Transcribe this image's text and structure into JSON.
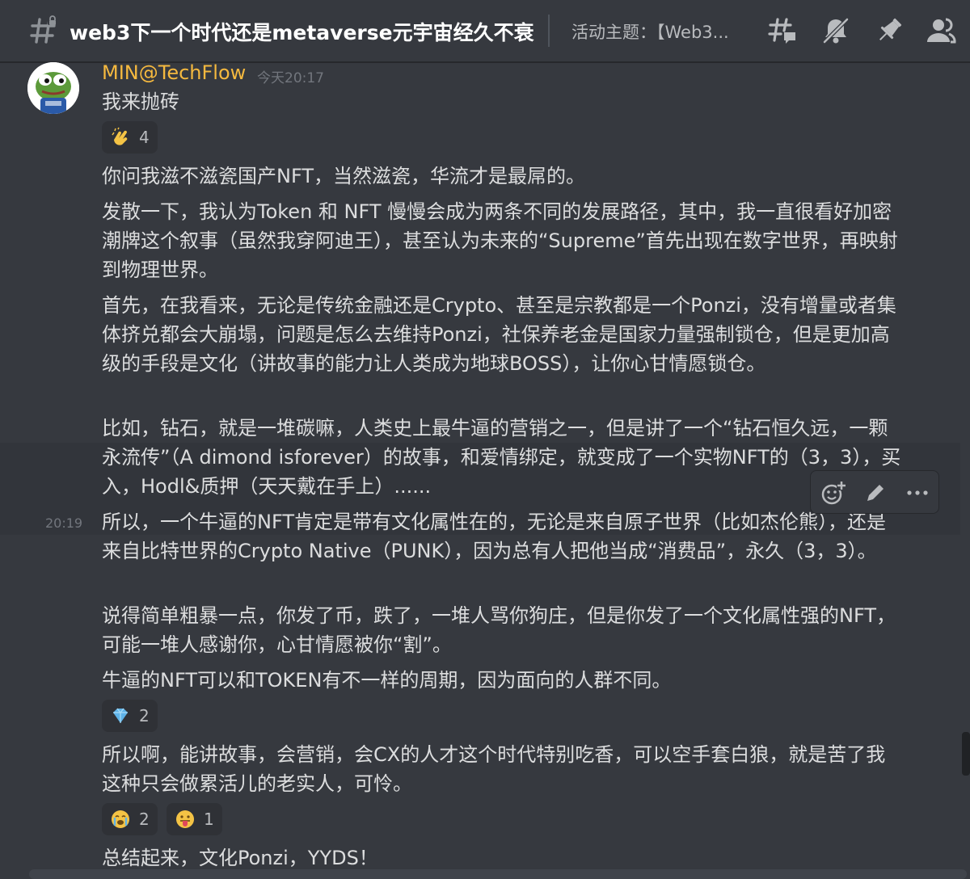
{
  "header": {
    "channel_name": "web3下一个时代还是metaverse元宇宙经久不衰",
    "topic": "活动主题：【Web3...",
    "icons": [
      "threads-icon",
      "mute-bell-icon",
      "pin-icon",
      "members-icon"
    ]
  },
  "message": {
    "author": "MIN@TechFlow",
    "author_color": "#f5b93f",
    "timestamp": "今天20:17",
    "side_timestamp": "20:19",
    "paragraphs": [
      "我来抛砖",
      "你问我滋不滋瓷国产NFT，当然滋瓷，华流才是最屌的。",
      "发散一下，我认为Token 和 NFT 慢慢会成为两条不同的发展路径，其中，我一直很看好加密潮牌这个叙事（虽然我穿阿迪王），甚至认为未来的“Supreme”首先出现在数字世界，再映射到物理世界。",
      "首先，在我看来，无论是传统金融还是Crypto、甚至是宗教都是一个Ponzi，没有增量或者集体挤兑都会大崩塌，问题是怎么去维持Ponzi，社保养老金是国家力量强制锁仓，但是更加高级的手段是文化（讲故事的能力让人类成为地球BOSS），让你心甘情愿锁仓。",
      "比如，钻石，就是一堆碳嘛，人类史上最牛逼的营销之一，但是讲了一个“钻石恒久远，一颗永流传”（A dimond isforever）的故事，和爱情绑定，就变成了一个实物NFT的（3，3），买入，Hodl&质押（天天戴在手上）......",
      "所以，一个牛逼的NFT肯定是带有文化属性在的，无论是来自原子世界（比如杰伦熊），还是来自比特世界的Crypto Native（PUNK），因为总有人把他当成“消费品”，永久（3，3）。",
      "说得简单粗暴一点，你发了币，跌了，一堆人骂你狗庄，但是你发了一个文化属性强的NFT，可能一堆人感谢你，心甘情愿被你“割”。",
      "牛逼的NFT可以和TOKEN有不一样的周期，因为面向的人群不同。",
      "所以啊，能讲故事，会营销，会CX的人才这个时代特别吃香，可以空手套白狼，就是苦了我这种只会做累活儿的老实人，可怜。",
      "总结起来，文化Ponzi，YYDS！"
    ],
    "reactions": {
      "clap": {
        "emoji": "clapping-hands",
        "count": "4"
      },
      "gem": {
        "emoji": "gem-stone",
        "count": "2"
      },
      "cry": {
        "emoji": "loudly-crying-face",
        "count": "2"
      },
      "tongue": {
        "emoji": "face-with-tongue",
        "count": "1"
      }
    }
  },
  "hover_toolbar": [
    "add-reaction-icon",
    "edit-icon",
    "more-icon"
  ],
  "colors": {
    "background": "#36393f",
    "text": "#dcddde",
    "muted": "#72767d",
    "reaction_bg": "#2f3136"
  }
}
